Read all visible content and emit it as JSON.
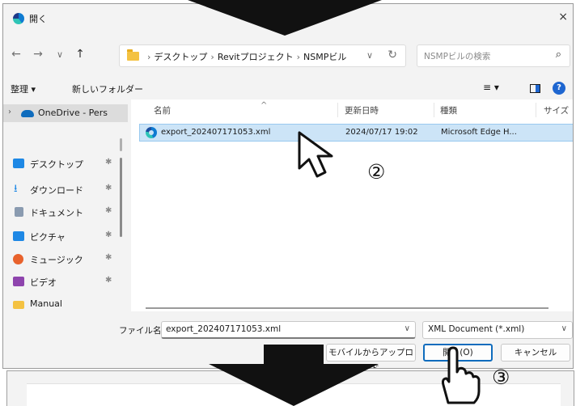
{
  "window": {
    "title": "開く",
    "close": "×"
  },
  "nav": {
    "back": "←",
    "forward": "→",
    "recent": "∨",
    "up": "↑"
  },
  "address": {
    "breadcrumbs": [
      "デスクトップ",
      "Revitプロジェクト",
      "NSMPビル"
    ],
    "separator": "›",
    "dropdown": "∨",
    "refresh": "↻"
  },
  "search": {
    "placeholder": "NSMPビルの検索",
    "icon": "⌕"
  },
  "toolbar": {
    "organize": "整理 ▾",
    "new_folder": "新しいフォルダー",
    "view": "≡ ▾",
    "help": "?"
  },
  "sidebar": {
    "onedrive": "OneDrive - Pers",
    "items": [
      {
        "label": "デスクトップ",
        "icon": "desktop-icon",
        "color": "#1e88e5"
      },
      {
        "label": "ダウンロード",
        "icon": "download-icon",
        "color": "#1e88e5"
      },
      {
        "label": "ドキュメント",
        "icon": "document-icon",
        "color": "#8a9bb0"
      },
      {
        "label": "ピクチャ",
        "icon": "picture-icon",
        "color": "#1e88e5"
      },
      {
        "label": "ミュージック",
        "icon": "music-icon",
        "color": "#e8622c"
      },
      {
        "label": "ビデオ",
        "icon": "video-icon",
        "color": "#8e44ad"
      },
      {
        "label": "Manual",
        "icon": "folder-icon",
        "color": "#f4c242"
      }
    ],
    "pin": "✱"
  },
  "columns": [
    "名前",
    "更新日時",
    "種類",
    "サイズ"
  ],
  "files": [
    {
      "name": "export_202407171053.xml",
      "modified": "2024/07/17 19:02",
      "type": "Microsoft Edge H..."
    }
  ],
  "filename": {
    "label": "ファイル名(N):",
    "value": "export_202407171053.xml",
    "dropdown": "∨"
  },
  "filetype": {
    "value": "XML Document (*.xml)",
    "dropdown": "∨"
  },
  "buttons": {
    "upload": "モバイルからアップロード",
    "open": "開く(O)",
    "cancel": "キャンセル"
  },
  "markers": {
    "step2": "②",
    "step3": "③"
  },
  "colors": {
    "selection": "#cce4f7",
    "accent": "#0f6cbd"
  }
}
